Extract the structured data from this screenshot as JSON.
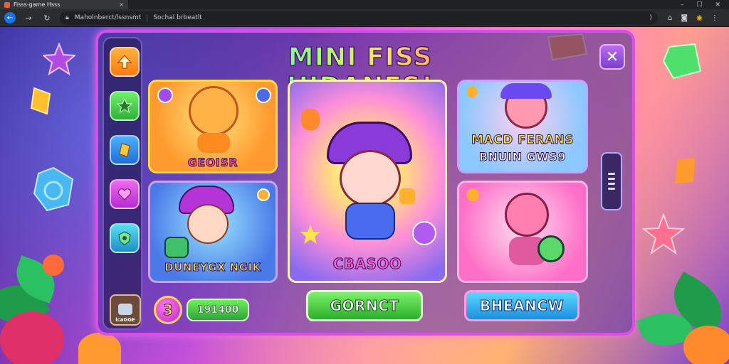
{
  "browser": {
    "tab_title": "Fisss-game Hsss",
    "tab_close": "×",
    "url_left": "Maholnberct/lssnsmt",
    "url_right": "Sochal brbeatlt"
  },
  "game": {
    "title": "MINI FISS HIDANES!",
    "close_label": "✕",
    "sidebar": [
      {
        "name": "arrow-up",
        "color": "#ff9b1f"
      },
      {
        "name": "star",
        "color": "#3fd04a"
      },
      {
        "name": "gem",
        "color": "#2f8ef0"
      },
      {
        "name": "heart",
        "color": "#d547e8"
      },
      {
        "name": "shield",
        "color": "#1fb6d8"
      }
    ],
    "sidebar_bottom_label": "lcaGGE",
    "cards": {
      "top_left": "GEOISR",
      "bottom_left": "DUNEYGX NGIK",
      "center": "CBASOO",
      "top_right_line1": "MACD FERANS",
      "top_right_line2": "BNUIN GWS9",
      "bottom_right": ""
    },
    "coin_value": "3",
    "score_value": "191400",
    "buttons": {
      "green": "GORNCT",
      "blue": "BHEANCW"
    }
  },
  "colors": {
    "accent_pink": "#d64fe8",
    "gold_border": "#ffd84a",
    "green_button": "#3ed43a",
    "blue_button": "#2fb8f0"
  }
}
